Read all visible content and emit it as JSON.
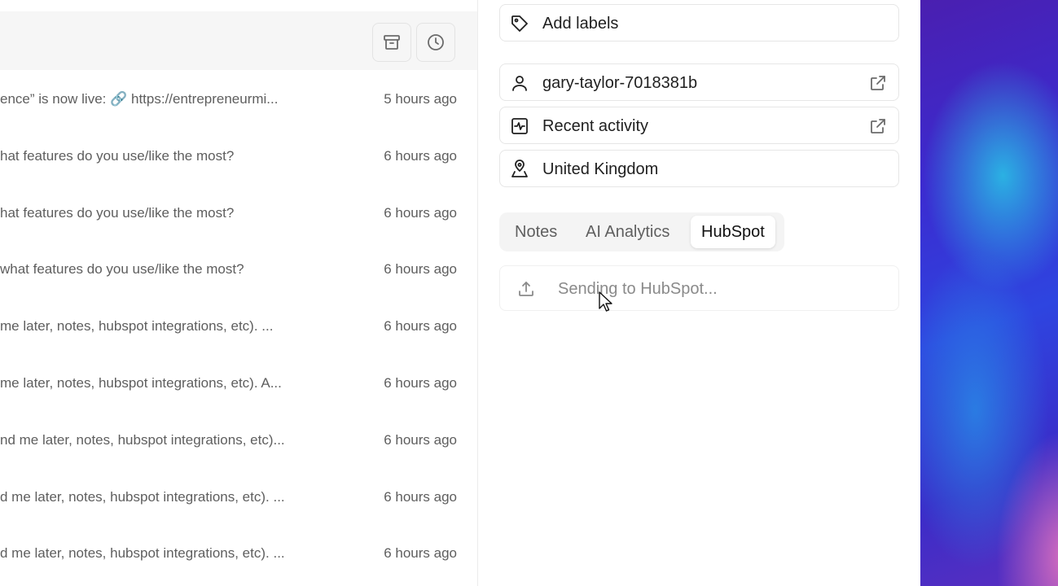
{
  "messages": [
    {
      "snippet": "ence” is now live: 🔗 https://entrepreneurmi...",
      "time": "5 hours ago"
    },
    {
      "snippet": "hat features do you use/like the most?",
      "time": "6 hours ago"
    },
    {
      "snippet": "hat features do you use/like the most?",
      "time": "6 hours ago"
    },
    {
      "snippet": "what features do you use/like the most?",
      "time": "6 hours ago"
    },
    {
      "snippet": " me later, notes, hubspot integrations, etc).  ...",
      "time": "6 hours ago"
    },
    {
      "snippet": "me later, notes, hubspot integrations, etc).  A...",
      "time": "6 hours ago"
    },
    {
      "snippet": "nd me later, notes, hubspot integrations, etc)...",
      "time": "6 hours ago"
    },
    {
      "snippet": "d me later, notes, hubspot integrations, etc). ...",
      "time": "6 hours ago"
    },
    {
      "snippet": "d me later, notes, hubspot integrations, etc).  ...",
      "time": "6 hours ago"
    }
  ],
  "toolbar": {
    "archive_icon": "archive-icon",
    "clock_icon": "clock-icon"
  },
  "contact": {
    "labels_text": "Add labels",
    "username": "gary-taylor-7018381b",
    "activity_text": "Recent activity",
    "location": "United Kingdom"
  },
  "tabs": {
    "notes": "Notes",
    "ai": "AI Analytics",
    "hubspot": "HubSpot",
    "active": "HubSpot"
  },
  "hubspot": {
    "status": "Sending to HubSpot..."
  },
  "colors": {
    "accent_text": "#1f1f1f",
    "muted_text": "#5e5e5e",
    "backdrop_start": "#4a1fb0",
    "backdrop_mid": "#2e45e0"
  }
}
